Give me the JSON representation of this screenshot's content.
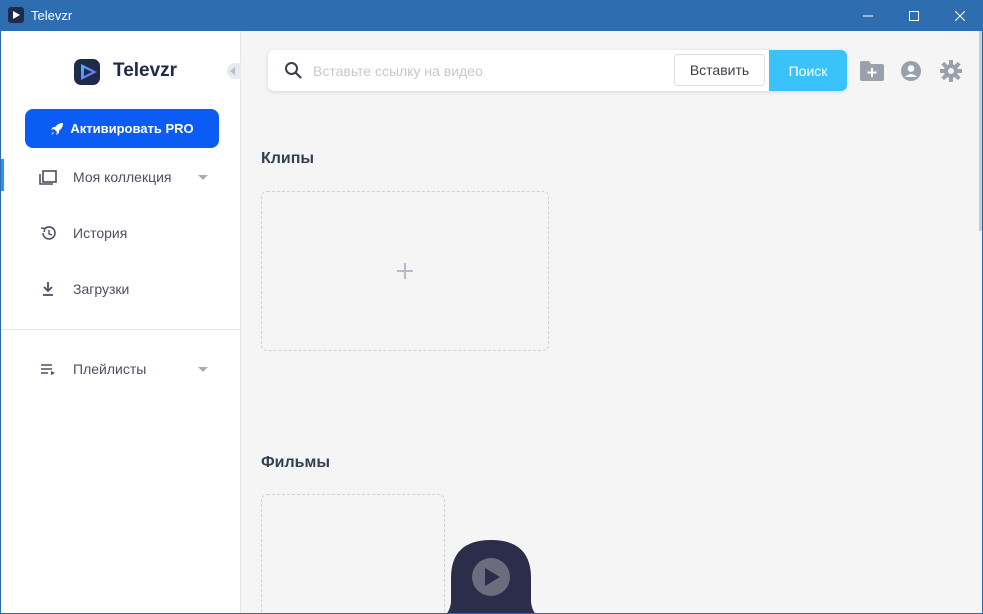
{
  "window": {
    "title": "Televzr",
    "colors": {
      "titlebar": "#2e6db0",
      "accent": "#0a5cf5",
      "search_button": "#3ac2fb"
    }
  },
  "sidebar": {
    "logo_text": "Televzr",
    "pro_button": "Активировать PRO",
    "items": [
      {
        "label": "Моя коллекция",
        "icon": "collection-icon",
        "has_caret": true,
        "active": true
      },
      {
        "label": "История",
        "icon": "history-icon",
        "has_caret": false
      },
      {
        "label": "Загрузки",
        "icon": "download-icon",
        "has_caret": false
      },
      {
        "label": "Плейлисты",
        "icon": "playlist-icon",
        "has_caret": true
      }
    ]
  },
  "search": {
    "placeholder": "Вставьте ссылку на видео",
    "value": "",
    "paste_label": "Вставить",
    "search_label": "Поиск"
  },
  "toolbar": {
    "icons": [
      "folder-add-icon",
      "user-icon",
      "settings-icon"
    ]
  },
  "main": {
    "sections": [
      {
        "title": "Клипы"
      },
      {
        "title": "Фильмы"
      }
    ]
  }
}
